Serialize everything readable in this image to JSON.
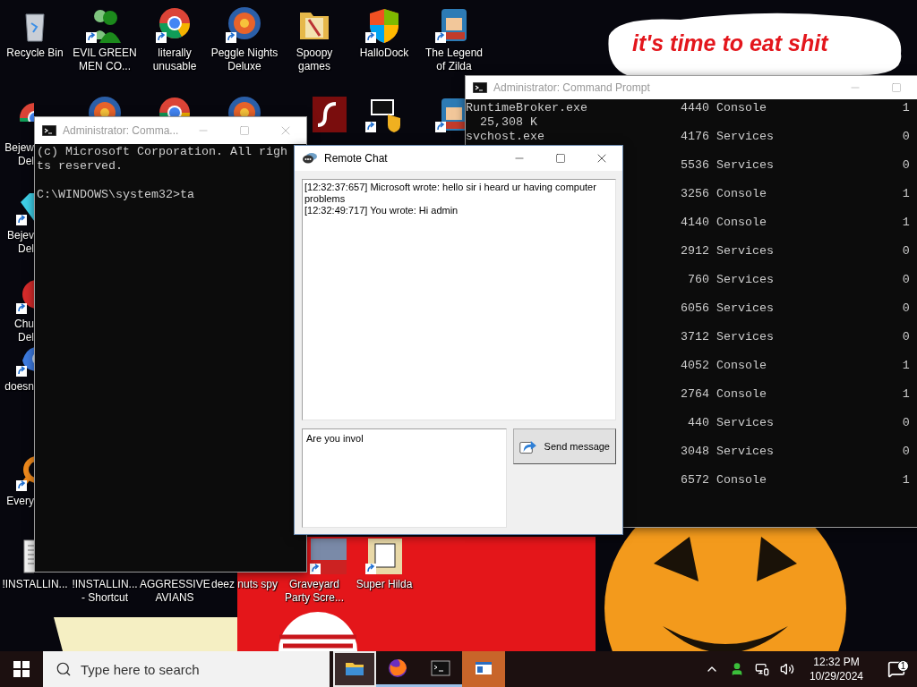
{
  "wallpaper": {
    "caption": "it's time to eat shit"
  },
  "desktop_icons": [
    {
      "lines": [
        "Recycle Bin"
      ]
    },
    {
      "lines": [
        "EVIL GREEN",
        "MEN CO..."
      ]
    },
    {
      "lines": [
        "literally",
        "unusable"
      ]
    },
    {
      "lines": [
        "Peggle Nights",
        "Deluxe"
      ]
    },
    {
      "lines": [
        "Spoopy",
        "games"
      ]
    },
    {
      "lines": [
        "HalloDock"
      ]
    },
    {
      "lines": [
        "The Legend",
        "of Zilda"
      ]
    },
    {
      "lines": [
        "Bejew",
        "Del"
      ]
    },
    {
      "lines": [
        "Bejev",
        "Del"
      ]
    },
    {
      "lines": [
        "Chu",
        "Del"
      ]
    },
    {
      "lines": [
        "doesn"
      ]
    },
    {
      "lines": [
        "Every"
      ]
    },
    {
      "lines": [
        "!INSTALLIN..."
      ]
    },
    {
      "lines": [
        "!INSTALLIN...",
        "- Shortcut"
      ]
    },
    {
      "lines": [
        "AGGRESSIVE",
        "AVIANS"
      ]
    },
    {
      "lines": [
        "deez nuts spy"
      ]
    },
    {
      "lines": [
        "Graveyard",
        "Party Scre..."
      ]
    },
    {
      "lines": [
        "Super Hilda"
      ]
    }
  ],
  "windows": [
    {
      "kind": "console",
      "title": "Administrator: Comma...",
      "active": false,
      "output": [
        "(c) Microsoft Corporation. All righ",
        "ts reserved."
      ],
      "prompt": "C:\\WINDOWS\\system32>ta"
    },
    {
      "kind": "tasklist",
      "title": "Administrator: Command Prompt",
      "active": false,
      "processes": [
        {
          "name": "RuntimeBroker.exe",
          "pid": "4440",
          "session": "Console",
          "column_4": "1",
          "memory": "25,308 K"
        },
        {
          "name": "svchost.exe",
          "pid": "4176",
          "session": "Services",
          "column_4": "0"
        },
        {
          "pid": "5536",
          "session": "Services",
          "column_4": "0"
        },
        {
          "pid": "3256",
          "session": "Console",
          "column_4": "1"
        },
        {
          "pid": "4140",
          "session": "Console",
          "column_4": "1"
        },
        {
          "pid": "2912",
          "session": "Services",
          "column_4": "0"
        },
        {
          "pid": "760",
          "session": "Services",
          "column_4": "0"
        },
        {
          "pid": "6056",
          "session": "Services",
          "column_4": "0"
        },
        {
          "pid": "3712",
          "session": "Services",
          "column_4": "0"
        },
        {
          "pid": "4052",
          "session": "Console",
          "column_4": "1"
        },
        {
          "pid": "2764",
          "session": "Console",
          "column_4": "1"
        },
        {
          "pid": "440",
          "session": "Services",
          "column_4": "0"
        },
        {
          "pid": "3048",
          "session": "Services",
          "column_4": "0"
        },
        {
          "pid": "6572",
          "session": "Console",
          "column_4": "1"
        }
      ]
    },
    {
      "kind": "chat",
      "title": "Remote Chat",
      "active": true,
      "messages": [
        "[12:32:37:657] Microsoft wrote: hello sir i heard ur having computer problems",
        "[12:32:49:717] You wrote: Hi admin"
      ],
      "input": {
        "value": "Are you invol"
      },
      "send_button": "Send message"
    }
  ],
  "taskbar": {
    "search": {
      "placeholder": "Type here to search"
    },
    "apps": [
      {
        "selected": true,
        "running": true,
        "flashing": false
      },
      {
        "selected": false,
        "running": true,
        "flashing": false
      },
      {
        "selected": false,
        "running": true,
        "flashing": false
      },
      {
        "selected": false,
        "running": false,
        "flashing": true
      }
    ],
    "clock": {
      "time": "12:32 PM",
      "date": "10/29/2024"
    },
    "notifications": {
      "count": "1"
    }
  }
}
